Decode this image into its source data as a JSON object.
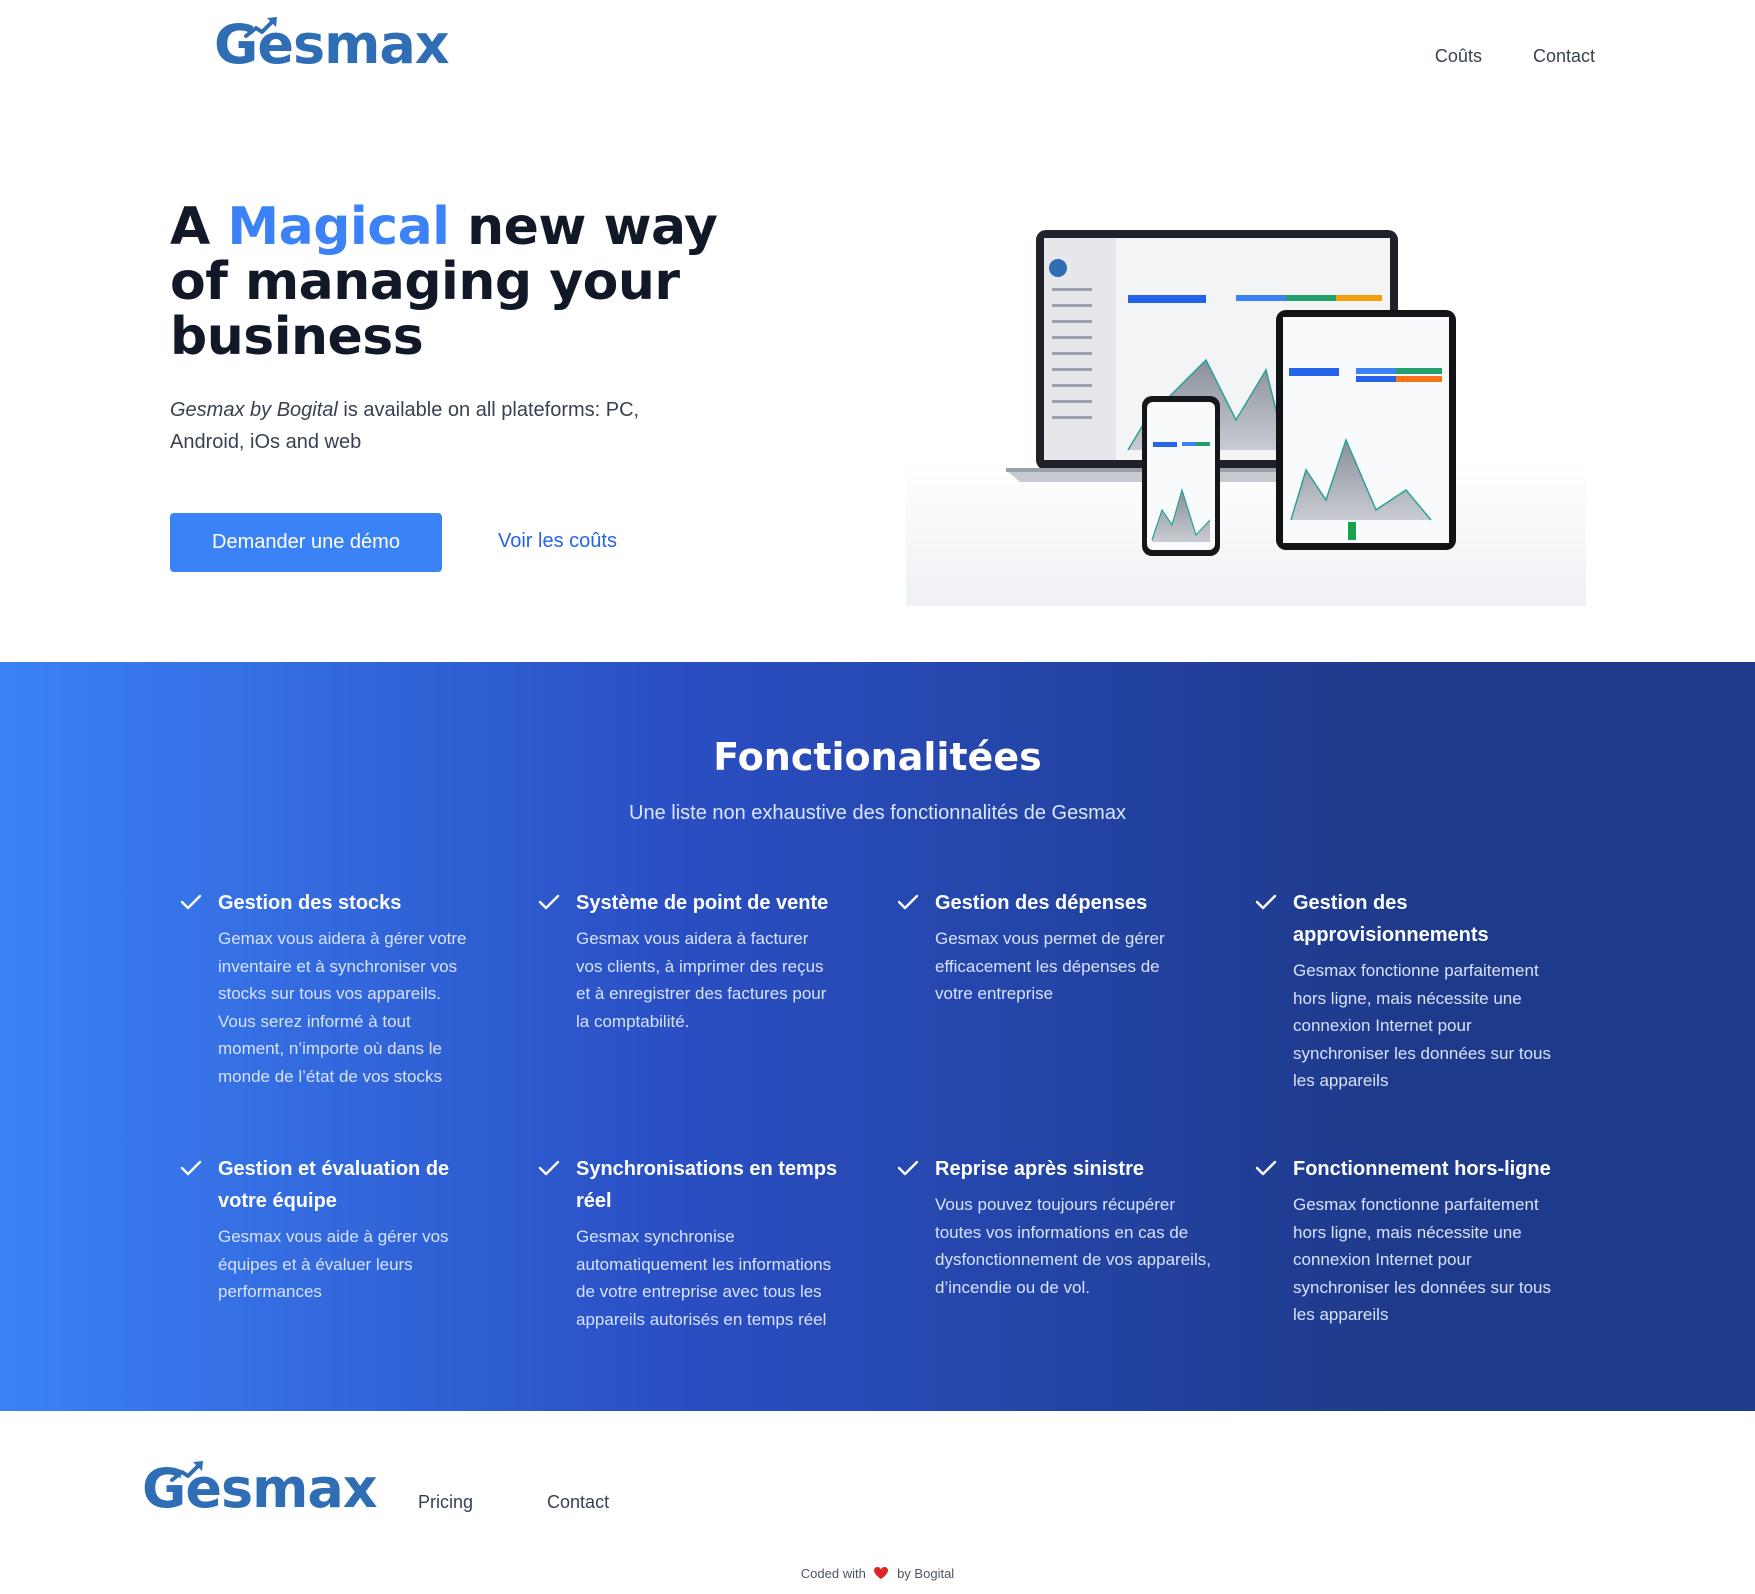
{
  "header": {
    "logo_text": "Gesmax",
    "nav": [
      {
        "label": "Coûts"
      },
      {
        "label": "Contact"
      }
    ]
  },
  "hero": {
    "title_prefix": "A ",
    "title_accent": "Magical",
    "title_rest": " new way of managing your business",
    "subtitle_italic": "Gesmax by Bogital",
    "subtitle_rest": " is available on all plateforms: PC, Android, iOs and web",
    "primary_button": "Demander une démo",
    "secondary_link": "Voir les coûts"
  },
  "features": {
    "title": "Fonctionalitées",
    "subtitle": "Une liste non exhaustive des fonctionnalités de Gesmax",
    "items": [
      {
        "title": "Gestion des stocks",
        "text": "Gemax vous aidera à gérer votre inventaire et à synchroniser vos stocks sur tous vos appareils. Vous serez informé à tout moment, n’importe où dans le monde de l’état de vos stocks"
      },
      {
        "title": "Système de point de vente",
        "text": "Gesmax vous aidera à facturer vos clients, à imprimer des reçus et à enregistrer des factures pour la comptabilité."
      },
      {
        "title": "Gestion des dépenses",
        "text": "Gesmax vous permet de gérer efficacement les dépenses de votre entreprise"
      },
      {
        "title": "Gestion des approvisionnements",
        "text": "Gesmax fonctionne parfaitement hors ligne, mais nécessite une connexion Internet pour synchroniser les données sur tous les appareils"
      },
      {
        "title": "Gestion et évaluation de votre équipe",
        "text": "Gesmax vous aide à gérer vos équipes et à évaluer leurs performances"
      },
      {
        "title": "Synchronisations en temps réel",
        "text": "Gesmax synchronise automatiquement les informations de votre entreprise avec tous les appareils autorisés en temps réel"
      },
      {
        "title": "Reprise après sinistre",
        "text": "Vous pouvez toujours récupérer toutes vos informations en cas de dysfonctionnement de vos appareils, d’incendie ou de vol."
      },
      {
        "title": "Fonctionnement hors-ligne",
        "text": "Gesmax fonctionne parfaitement hors ligne, mais nécessite une connexion Internet pour synchroniser les données sur tous les appareils"
      }
    ]
  },
  "footer": {
    "logo_text": "Gesmax",
    "nav": [
      {
        "label": "Pricing"
      },
      {
        "label": "Contact"
      }
    ],
    "credit_prefix": "Coded with",
    "credit_suffix": "by Bogital"
  },
  "colors": {
    "accent": "#3b82f6",
    "logo": "#2f6db5",
    "band_start": "#3b82f6",
    "band_end": "#1e3a8a"
  },
  "icons": [
    "trend-arrow-icon",
    "check-icon",
    "heart-icon"
  ]
}
